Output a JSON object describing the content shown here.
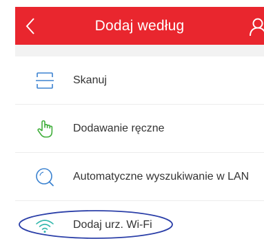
{
  "header": {
    "title": "Dodaj według",
    "background": "#e9262e",
    "back_icon": "chevron-left-icon",
    "user_icon": "user-icon"
  },
  "menu": {
    "items": [
      {
        "label": "Skanuj",
        "icon": "scan-icon",
        "icon_color": "#3b82d0"
      },
      {
        "label": "Dodawanie ręczne",
        "icon": "hand-pointer-icon",
        "icon_color": "#3fae3a"
      },
      {
        "label": "Automatyczne wyszukiwanie w LAN",
        "icon": "search-icon",
        "icon_color": "#3b82d0"
      },
      {
        "label": "Dodaj urz. Wi-Fi",
        "icon": "wifi-icon",
        "icon_color": "#35b8ad"
      }
    ]
  },
  "annotation": {
    "ellipse_color": "#2b3fa8"
  }
}
